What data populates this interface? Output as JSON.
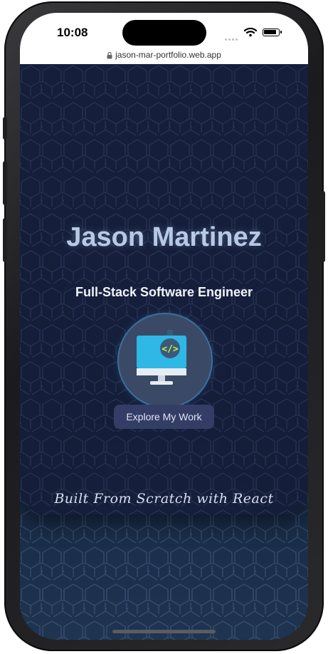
{
  "status_bar": {
    "time": "10:08",
    "url": "jason-mar-portfolio.web.app"
  },
  "hero": {
    "name": "Jason Martinez",
    "title": "Full-Stack Software Engineer",
    "avatar_icon": "computer-code-gear-icon",
    "cta_label": "Explore My Work",
    "footer_text": "Built From Scratch with React"
  },
  "colors": {
    "background": "#142540",
    "card": "#141c38",
    "name_text": "#b8c9e4",
    "cta_bg": "#343d66",
    "accent": "#2fb7e6"
  }
}
